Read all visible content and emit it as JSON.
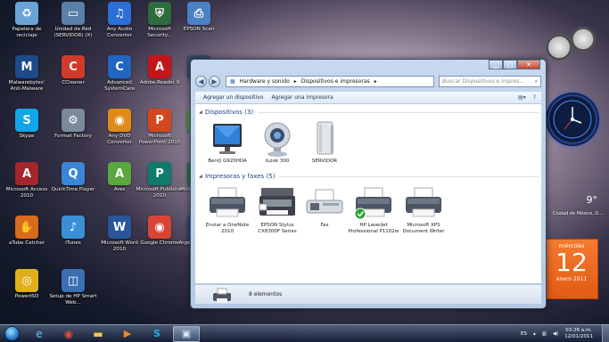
{
  "desktop": {
    "icons": [
      {
        "label": "Papelera de reciclaje",
        "icon": "recycle-bin-icon",
        "color": "#6aa4d6",
        "glyph": "♻"
      },
      {
        "label": "Unidad de Red (SERVIDOR) (X)",
        "icon": "network-drive-icon",
        "color": "#5a7fa8",
        "glyph": "▭"
      },
      {
        "label": "Any Audio Converter",
        "icon": "audio-converter-icon",
        "color": "#2c6fd6",
        "glyph": "♫"
      },
      {
        "label": "Microsoft Security...",
        "icon": "security-essentials-icon",
        "color": "#2e6b3e",
        "glyph": "⛨"
      },
      {
        "label": "EPSON Scan",
        "icon": "scanner-icon",
        "color": "#4b81c5",
        "glyph": "⎙"
      },
      {
        "label": "Malwarebytes' Anti-Malware",
        "icon": "malwarebytes-icon",
        "color": "#1d4a88",
        "glyph": "M"
      },
      {
        "label": "CCleaner",
        "icon": "ccleaner-icon",
        "color": "#d03a2a",
        "glyph": "C"
      },
      {
        "label": "Advanced SystemCare",
        "icon": "systemcare-icon",
        "color": "#2166c0",
        "glyph": "C"
      },
      {
        "label": "Adobe Reader 9",
        "icon": "adobe-reader-icon",
        "color": "#c3161c",
        "glyph": "A"
      },
      {
        "label": "Photo...",
        "icon": "photo-icon",
        "color": "#3a4e6a",
        "glyph": "P"
      },
      {
        "label": "Skype",
        "icon": "skype-icon",
        "color": "#12a5e7",
        "glyph": "S"
      },
      {
        "label": "Format Factory",
        "icon": "format-factory-icon",
        "color": "#7a8a9a",
        "glyph": "⚙"
      },
      {
        "label": "Any DVD Converter",
        "icon": "dvd-converter-icon",
        "color": "#e08a1a",
        "glyph": "◉"
      },
      {
        "label": "Microsoft PowerPoint 2010",
        "icon": "powerpoint-icon",
        "color": "#d2471c",
        "glyph": "P"
      },
      {
        "label": "Ares",
        "icon": "ares-icon",
        "color": "#4f9a3a",
        "glyph": "A"
      },
      {
        "label": "Microsoft Access 2010",
        "icon": "access-icon",
        "color": "#a4262c",
        "glyph": "A"
      },
      {
        "label": "QuickTime Player",
        "icon": "quicktime-icon",
        "color": "#3a86d6",
        "glyph": "Q"
      },
      {
        "label": "Ares",
        "icon": "ares-icon",
        "color": "#5aa83e",
        "glyph": "A"
      },
      {
        "label": "Microsoft Publisher 2010",
        "icon": "publisher-icon",
        "color": "#0f7b6c",
        "glyph": "P"
      },
      {
        "label": "Microsoft Excel 2010",
        "icon": "excel-icon",
        "color": "#1f7a3f",
        "glyph": "X"
      },
      {
        "label": "aTube Catcher",
        "icon": "atube-catcher-icon",
        "color": "#d76b1e",
        "glyph": "✋"
      },
      {
        "label": "iTunes",
        "icon": "itunes-icon",
        "color": "#3a8fd6",
        "glyph": "♪"
      },
      {
        "label": "Microsoft Word 2010",
        "icon": "word-icon",
        "color": "#2a5599",
        "glyph": "W"
      },
      {
        "label": "Google Chrome",
        "icon": "chrome-icon",
        "color": "#d94436",
        "glyph": "◉"
      },
      {
        "label": "Argente Utilities",
        "icon": "argente-icon",
        "color": "#2d4c7a",
        "glyph": "A"
      },
      {
        "label": "PowerISO",
        "icon": "poweriso-icon",
        "color": "#e0b01c",
        "glyph": "◎"
      },
      {
        "label": "Setup de HP Smart Web...",
        "icon": "hp-setup-icon",
        "color": "#3b6fb2",
        "glyph": "◫"
      }
    ]
  },
  "window": {
    "address_parts": [
      "Hardware y sonido",
      "▸",
      "Dispositivos e impresoras",
      "▸"
    ],
    "search_placeholder": "Buscar Dispositivos e impres...",
    "toolbar": {
      "add_device": "Agregar un dispositivo",
      "add_printer": "Agregar una impresora"
    },
    "devices_header": "Dispositivos (3)",
    "devices": [
      {
        "label": "BenQ G920HDA",
        "icon": "monitor-icon"
      },
      {
        "label": "iLook 300",
        "icon": "webcam-icon"
      },
      {
        "label": "SERVIDOR",
        "icon": "server-icon"
      }
    ],
    "printers_header": "Impresoras y faxes (5)",
    "printers": [
      {
        "label": "Enviar a OneNote 2010",
        "icon": "printer-icon",
        "default": false
      },
      {
        "label": "EPSON Stylus CX8300F Series",
        "icon": "multifunction-printer-icon",
        "default": false
      },
      {
        "label": "Fax",
        "icon": "fax-icon",
        "default": false
      },
      {
        "label": "HP LaserJet Professional P1102w",
        "icon": "printer-icon",
        "default": true
      },
      {
        "label": "Microsoft XPS Document Writer",
        "icon": "printer-icon",
        "default": false
      }
    ],
    "details": {
      "count": "8 elementos"
    }
  },
  "gadgets": {
    "weather_temp": "9°",
    "weather_city": "Ciudad de México, D...",
    "calendar": {
      "weekday": "miércoles",
      "day": "12",
      "month": "enero 2011"
    }
  },
  "taskbar": {
    "language": "ES",
    "time": "03:26 a.m.",
    "date": "12/01/2011"
  }
}
